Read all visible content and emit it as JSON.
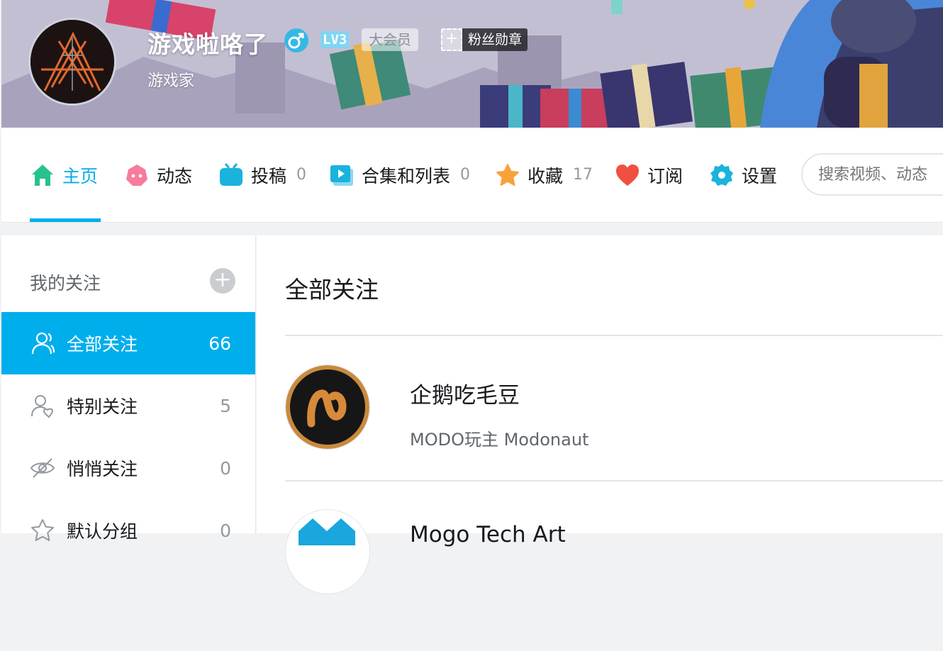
{
  "header": {
    "username": "游戏啦咯了",
    "level": "LV3",
    "vip_label": "大会员",
    "medal_label": "粉丝勋章",
    "signature": "游戏家"
  },
  "nav": {
    "items": [
      {
        "label": "主页",
        "icon": "home-icon",
        "count": ""
      },
      {
        "label": "动态",
        "icon": "dynamic-icon",
        "count": ""
      },
      {
        "label": "投稿",
        "icon": "tv-icon",
        "count": "0"
      },
      {
        "label": "合集和列表",
        "icon": "playlist-icon",
        "count": "0"
      },
      {
        "label": "收藏",
        "icon": "star-icon",
        "count": "17"
      },
      {
        "label": "订阅",
        "icon": "heart-icon",
        "count": ""
      },
      {
        "label": "设置",
        "icon": "gear-icon",
        "count": ""
      }
    ],
    "search_placeholder": "搜索视频、动态"
  },
  "sidebar": {
    "title": "我的关注",
    "items": [
      {
        "label": "全部关注",
        "count": "66",
        "icon": "people-icon"
      },
      {
        "label": "特别关注",
        "count": "5",
        "icon": "user-heart-icon"
      },
      {
        "label": "悄悄关注",
        "count": "0",
        "icon": "eye-off-icon"
      },
      {
        "label": "默认分组",
        "count": "0",
        "icon": "star-outline-icon"
      }
    ]
  },
  "main": {
    "title": "全部关注",
    "follows": [
      {
        "name": "企鹅吃毛豆",
        "desc": "MODO玩主 Modonaut"
      },
      {
        "name": "Mogo Tech Art",
        "desc": ""
      }
    ]
  },
  "colors": {
    "accent": "#00aeec",
    "text": "#18191c",
    "muted": "#9499a0"
  }
}
